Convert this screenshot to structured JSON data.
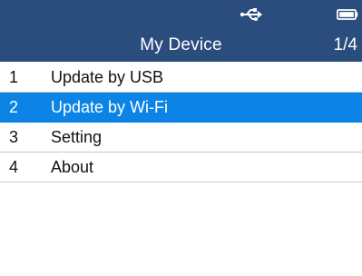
{
  "statusbar": {
    "usb_icon": "usb-icon",
    "battery_icon": "battery-icon",
    "color": "#2b4d7e"
  },
  "header": {
    "title": "My Device",
    "page_indicator": "1/4"
  },
  "menu": {
    "selected_index": 1,
    "selected_color": "#0b84e6",
    "items": [
      {
        "number": "1",
        "label": "Update by USB"
      },
      {
        "number": "2",
        "label": "Update by Wi-Fi"
      },
      {
        "number": "3",
        "label": "Setting"
      },
      {
        "number": "4",
        "label": "About"
      }
    ]
  }
}
